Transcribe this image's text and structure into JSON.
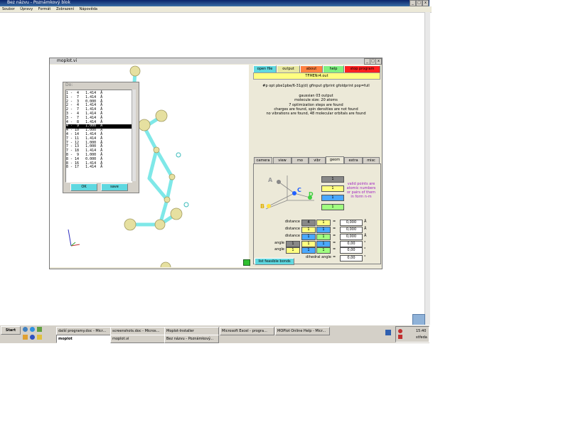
{
  "outer_window": {
    "title": "Bez názvu - Poznámkový blok",
    "menu": [
      "Soubor",
      "Úpravy",
      "Formát",
      "Zobrazení",
      "Nápověda"
    ],
    "min": "_",
    "max": "□",
    "close": "x"
  },
  "app_window": {
    "title": "moplot.vi",
    "min": "_",
    "max": "□",
    "close": "x",
    "top_buttons": {
      "open_file": "open file",
      "output": "output",
      "about": "about",
      "help": "help",
      "stop_program": "stop program"
    },
    "filename": "TFMENr4.out",
    "route_line": "#p opt pbe1pbe/6-31g(d) gfinput gfprint gfoldprint pop=full",
    "info_lines": [
      "gaussian 03 output",
      "molecule size: 20 atoms",
      "7 optimization steps are found",
      "charges are found, spin densities are not found",
      "no vibrations are found, 48 molecular orbitals are found"
    ],
    "tabs": [
      "camera",
      "view",
      "mo",
      "vibr",
      "geom",
      "extra",
      "misc"
    ],
    "active_tab": "geom",
    "geom": {
      "point_labels": {
        "a": "A",
        "b": "B",
        "c": "C",
        "d": "D"
      },
      "point_values": [
        "1",
        "1",
        "1",
        "1"
      ],
      "hint": "valid points are atomic numbers or pairs of them in form n-m",
      "rows": [
        {
          "label": "distance",
          "a": "4",
          "b": "1",
          "eq": "=",
          "value": "0,000",
          "unit": "Å"
        },
        {
          "label": "distance",
          "a": "1",
          "b": "1",
          "eq": "=",
          "value": "0,000",
          "unit": "Å"
        },
        {
          "label": "distance",
          "a": "1",
          "b": "1",
          "eq": "=",
          "value": "0,000",
          "unit": "Å"
        },
        {
          "label": "angle",
          "a": "1",
          "b": "1",
          "c": "1",
          "eq": "=",
          "value": "0,00",
          "unit": "°"
        },
        {
          "label": "angle",
          "a": "1",
          "b": "1",
          "c": "1",
          "eq": "=",
          "value": "0,00",
          "unit": "°"
        }
      ],
      "dihedral": {
        "label": "dihedral angle",
        "eq": "=",
        "value": "0,00",
        "unit": "°"
      },
      "list_bonds": "list feasible bonds"
    }
  },
  "bonds_dialog": {
    "title": "Do:",
    "rows": [
      "1 -  4   1.414  Å",
      "1 -  7   1.414  Å",
      "2 -  3   0.000  Å",
      "2 -  4   1.414  Å",
      "2 -  7   1.414  Å",
      "3 -  4   1.414  Å",
      "3 -  7   1.414  Å",
      "4 -  8   1.414  Å",
      "4 -  9   1.000  Å",
      "4 - 10   1.000  Å",
      "4 - 14   1.414  Å",
      "7 - 11   1.414  Å",
      "7 - 12   1.000  Å",
      "7 - 13   1.000  Å",
      "7 - 18   1.414  Å",
      "8 -  9   1.000  Å",
      "8 - 14   0.000  Å",
      "8 - 16   1.414  Å",
      "8 - 17   1.414  Å"
    ],
    "selected_index": 8,
    "ok": "OK",
    "save": "save"
  },
  "taskbar": {
    "start": "Start",
    "tasks_row1": [
      "další programy.doc - Micr...",
      "screenshots.doc - Micros...",
      "Moplot-Installer",
      "Microsoft Excel - progra...",
      "MOPlot Online Help - Micr..."
    ],
    "tasks_row2": [
      "moplot",
      "moplot.vi",
      "Bez názvu - Poznámkový..."
    ],
    "clock": "15:40",
    "day": "středa"
  },
  "colors": {
    "titlebar": "#0a246a",
    "bond": "#7fe8e8",
    "atom": "#e6e0a0",
    "btn_open": "#5fd8e0",
    "btn_output": "#e8e8a0",
    "btn_about": "#ff8040",
    "btn_help": "#80f080",
    "btn_stop": "#ff2020",
    "yellow_cell": "#ffff80",
    "blue_cell": "#4aa8ff",
    "green_cell": "#a0ff80"
  }
}
